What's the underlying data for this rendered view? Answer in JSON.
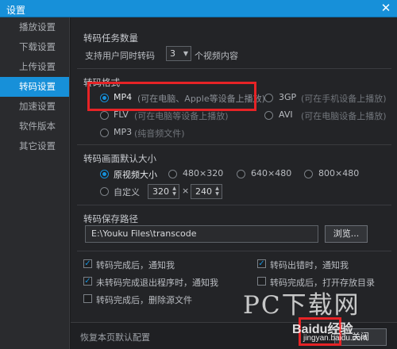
{
  "window": {
    "title": "设置",
    "close_glyph": "✕"
  },
  "sidebar": {
    "items": [
      {
        "label": "播放设置",
        "active": false
      },
      {
        "label": "下载设置",
        "active": false
      },
      {
        "label": "上传设置",
        "active": false
      },
      {
        "label": "转码设置",
        "active": true
      },
      {
        "label": "加速设置",
        "active": false
      },
      {
        "label": "软件版本",
        "active": false
      },
      {
        "label": "其它设置",
        "active": false
      }
    ]
  },
  "tasks": {
    "section_title": "转码任务数量",
    "prefix": "支持用户同时转码",
    "value": "3",
    "suffix": "个视频内容"
  },
  "format": {
    "section_title": "转码格式",
    "options": [
      {
        "label": "MP4",
        "note": "(可在电脑、Apple等设备上播放)",
        "selected": true
      },
      {
        "label": "3GP",
        "note": "(可在手机设备上播放)",
        "selected": false
      },
      {
        "label": "FLV",
        "note": "(可在电脑等设备上播放)",
        "selected": false
      },
      {
        "label": "AVI",
        "note": "(可在电脑设备上播放)",
        "selected": false
      },
      {
        "label": "MP3",
        "note": "(纯音频文件)",
        "selected": false
      }
    ]
  },
  "size": {
    "section_title": "转码画面默认大小",
    "options": [
      {
        "label": "原视频大小",
        "selected": true
      },
      {
        "label": "480×320",
        "selected": false
      },
      {
        "label": "640×480",
        "selected": false
      },
      {
        "label": "800×480",
        "selected": false
      }
    ],
    "custom_label": "自定义",
    "width": "320",
    "times": "×",
    "height": "240"
  },
  "path": {
    "section_title": "转码保存路径",
    "value": "E:\\Youku Files\\transcode",
    "browse_label": "浏览..."
  },
  "notify": {
    "options": [
      {
        "label": "转码完成后，通知我",
        "checked": true
      },
      {
        "label": "转码出错时，通知我",
        "checked": true
      },
      {
        "label": "未转码完成退出程序时，通知我",
        "checked": true
      },
      {
        "label": "转码完成后，打开存放目录",
        "checked": false
      },
      {
        "label": "转码完成后，删除源文件",
        "checked": false
      }
    ]
  },
  "footer": {
    "restore_label": "恢复本页默认配置",
    "close_label": "关闭"
  },
  "watermark": {
    "site_text": "PC下载网",
    "baidu_text": "Baidu经验",
    "baidu_url": "jingyan.baidu.com"
  },
  "colors": {
    "accent": "#1790d9",
    "highlight_box": "#e62326"
  }
}
